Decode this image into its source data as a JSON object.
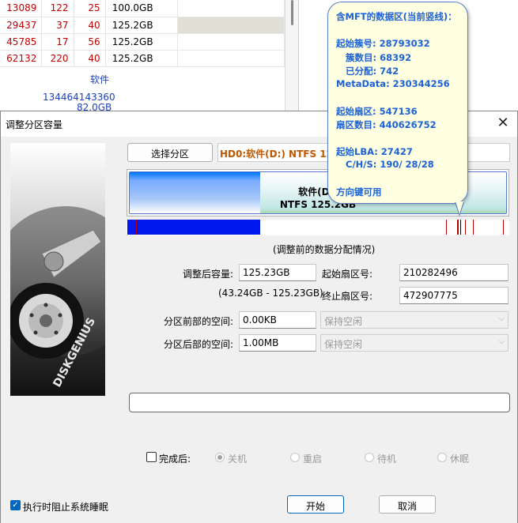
{
  "background": {
    "rows": [
      {
        "c1": "13089",
        "c2": "122",
        "c3": "25",
        "size": "100.0GB"
      },
      {
        "c1": "29437",
        "c2": "37",
        "c3": "40",
        "size": "125.2GB"
      },
      {
        "c1": "45785",
        "c2": "17",
        "c3": "56",
        "size": "125.2GB"
      },
      {
        "c1": "62132",
        "c2": "220",
        "c3": "40",
        "size": "125.2GB"
      }
    ],
    "label_software": "软件",
    "value_sectors": "134464143360",
    "value_size": "82.0GB"
  },
  "dialog": {
    "title": "调整分区容量",
    "select_partition_label": "选择分区",
    "partition_header": "HD0:软件(D:)  NTFS  125.2GB",
    "bar_line1": "软件(D:)",
    "bar_line2": "NTFS 125.2GB",
    "map_caption": "(调整前的数据分配情况)",
    "adjusted_size_label": "调整后容量:",
    "adjusted_size_value": "125.23GB",
    "range_text": "(43.24GB - 125.23GB)",
    "start_sector_label": "起始扇区号:",
    "start_sector_value": "210282496",
    "end_sector_label": "终止扇区号:",
    "end_sector_value": "472907775",
    "before_space_label": "分区前部的空间:",
    "before_space_value": "0.00KB",
    "before_space_option": "保持空闲",
    "after_space_label": "分区后部的空间:",
    "after_space_value": "1.00MB",
    "after_space_option": "保持空闲",
    "after_done_label": "完成后:",
    "options": {
      "shutdown": "关机",
      "restart": "重启",
      "standby": "待机",
      "hibernate": "休眠"
    },
    "prevent_sleep_label": "执行时阻止系统睡眠",
    "start_button": "开始",
    "cancel_button": "取消",
    "colors": {
      "accent": "#0067c0",
      "partition_header": "#c05800",
      "tooltip_text": "#1c61d8",
      "map_blue": "#0018f0"
    }
  },
  "tooltip": {
    "title": "含MFT的数据区(当前竖线)：",
    "start_cluster": "起始簇号: 28793032",
    "cluster_count": "簇数目: 68392",
    "allocated": "已分配: 742",
    "metadata": "MetaData: 230344256",
    "start_sector": "起始扇区: 547136",
    "sector_count": "扇区数目: 440626752",
    "start_lba": "起始LBA: 27427",
    "chs": "C/H/S: 190/ 28/28",
    "hint": "方向键可用"
  }
}
